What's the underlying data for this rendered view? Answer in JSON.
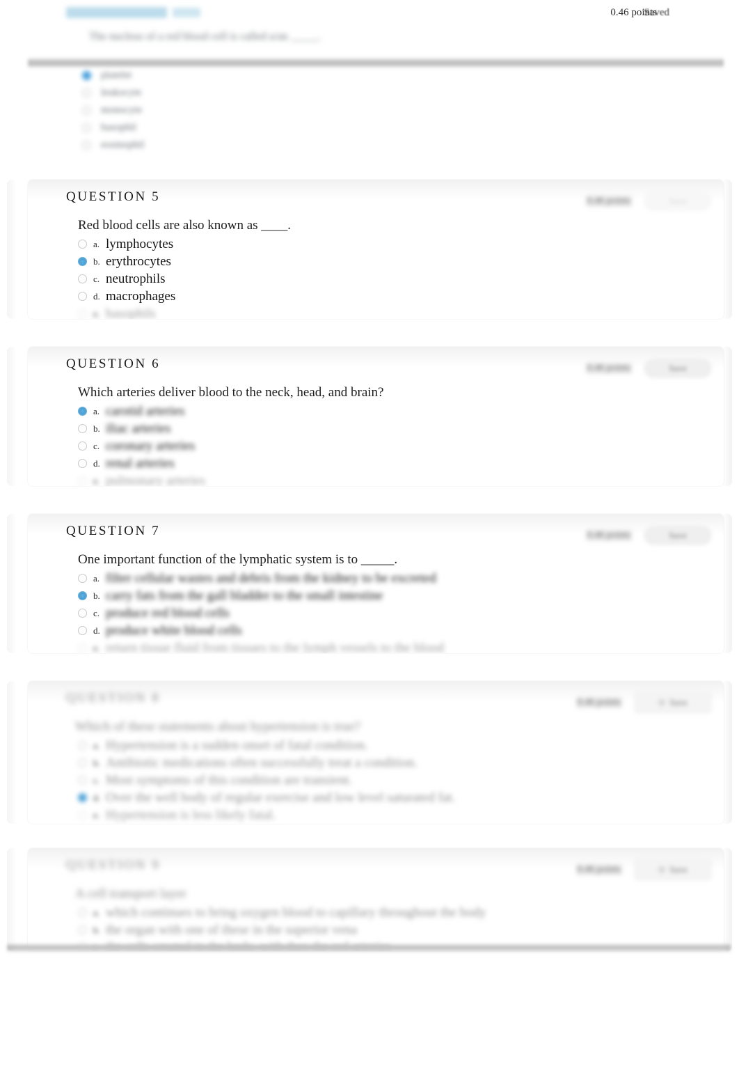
{
  "page": {
    "header": {
      "points_label": "0.46 points",
      "status_label": "Saved"
    }
  },
  "questions": [
    {
      "id": "q4",
      "title": "QUESTION 4",
      "stem": "The nucleus of a red blood cell is called a/an _____.",
      "blurred": true,
      "options": [
        {
          "letter": "a.",
          "label": "platelet",
          "selected": true
        },
        {
          "letter": "b.",
          "label": "leukocyte",
          "selected": false
        },
        {
          "letter": "c.",
          "label": "monocyte",
          "selected": false
        },
        {
          "letter": "d.",
          "label": "basophil",
          "selected": false
        },
        {
          "letter": "e.",
          "label": "eosinophil",
          "selected": false
        }
      ]
    },
    {
      "id": "q5",
      "title": "QUESTION 5",
      "stem": "Red blood cells are also known as ____.",
      "blurred": false,
      "points_label": "0.46 points",
      "save_label": "Save",
      "options": [
        {
          "letter": "a.",
          "label": "lymphocytes",
          "selected": false
        },
        {
          "letter": "b.",
          "label": "erythrocytes",
          "selected": true
        },
        {
          "letter": "c.",
          "label": "neutrophils",
          "selected": false
        },
        {
          "letter": "d.",
          "label": "macrophages",
          "selected": false
        },
        {
          "letter": "e.",
          "label": "basophils",
          "selected": false
        }
      ]
    },
    {
      "id": "q6",
      "title": "QUESTION 6",
      "stem": "Which arteries deliver blood to the neck, head, and brain?",
      "blurred": false,
      "points_label": "0.46 points",
      "save_label": "Save",
      "options": [
        {
          "letter": "a.",
          "label": "carotid arteries",
          "selected": true
        },
        {
          "letter": "b.",
          "label": "iliac arteries",
          "selected": false
        },
        {
          "letter": "c.",
          "label": "coronary arteries",
          "selected": false
        },
        {
          "letter": "d.",
          "label": "renal arteries",
          "selected": false
        },
        {
          "letter": "e.",
          "label": "pulmonary arteries",
          "selected": false
        }
      ]
    },
    {
      "id": "q7",
      "title": "QUESTION 7",
      "stem": "One important function of the lymphatic system is to _____.",
      "blurred": false,
      "points_label": "0.46 points",
      "save_label": "Save",
      "options": [
        {
          "letter": "a.",
          "label": "filter cellular wastes and debris from the kidney to be excreted",
          "selected": false
        },
        {
          "letter": "b.",
          "label": "carry fats from the gall bladder to the small intestine",
          "selected": true
        },
        {
          "letter": "c.",
          "label": "produce red blood cells",
          "selected": false
        },
        {
          "letter": "d.",
          "label": "produce white blood cells",
          "selected": false
        },
        {
          "letter": "e.",
          "label": "return tissue fluid from tissues to the lymph vessels to the blood",
          "selected": false
        }
      ]
    },
    {
      "id": "q8",
      "title": "QUESTION 8",
      "stem": "Which of these statements about hypertension is true?",
      "blurred": true,
      "points_label": "0.46 points",
      "save_label": "Save",
      "options": [
        {
          "letter": "a.",
          "label": "Hypertension is a sudden onset of fatal condition.",
          "selected": false
        },
        {
          "letter": "b.",
          "label": "Antibiotic medications often successfully treat a condition.",
          "selected": false
        },
        {
          "letter": "c.",
          "label": "Most symptoms of this condition are transient.",
          "selected": false
        },
        {
          "letter": "d.",
          "label": "Over the well body of regular exercise and low level saturated fat.",
          "selected": true
        },
        {
          "letter": "e.",
          "label": "Hypertension is less likely fatal.",
          "selected": false
        }
      ]
    },
    {
      "id": "q9",
      "title": "QUESTION 9",
      "stem": "A cell transport layer",
      "blurred": true,
      "points_label": "0.46 points",
      "save_label": "Save",
      "options": [
        {
          "letter": "a.",
          "label": "which continues to bring oxygen blood to capillary throughout the body",
          "selected": false
        },
        {
          "letter": "b.",
          "label": "the organ with one of these in the superior vena",
          "selected": false
        },
        {
          "letter": "c.",
          "label": "the cells created in the body, with they the red arteries",
          "selected": false
        }
      ]
    }
  ]
}
